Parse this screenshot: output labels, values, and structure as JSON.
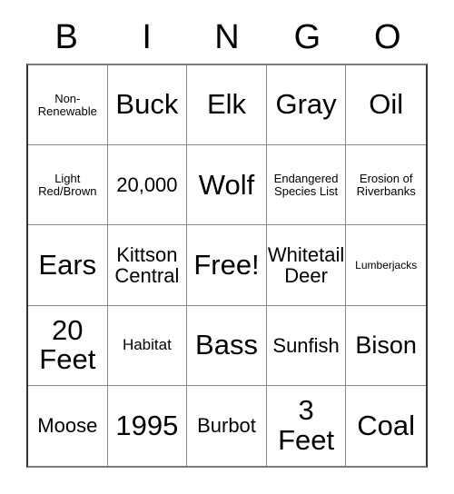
{
  "card": {
    "header_letters": [
      "B",
      "I",
      "N",
      "G",
      "O"
    ],
    "free_space_label": "Free!",
    "rows": [
      [
        {
          "text": "Non-\nRenewable",
          "size": "xs"
        },
        {
          "text": "Buck",
          "size": "xl"
        },
        {
          "text": "Elk",
          "size": "xl"
        },
        {
          "text": "Gray",
          "size": "xl"
        },
        {
          "text": "Oil",
          "size": "xl"
        }
      ],
      [
        {
          "text": "Light\nRed/Brown",
          "size": "xs"
        },
        {
          "text": "20,000",
          "size": "md"
        },
        {
          "text": "Wolf",
          "size": "xl"
        },
        {
          "text": "Endangered\nSpecies List",
          "size": "xs"
        },
        {
          "text": "Erosion of\nRiverbanks",
          "size": "xs"
        }
      ],
      [
        {
          "text": "Ears",
          "size": "xl"
        },
        {
          "text": "Kittson\nCentral",
          "size": "md"
        },
        {
          "text": "Free!",
          "size": "xl"
        },
        {
          "text": "Whitetail\nDeer",
          "size": "md"
        },
        {
          "text": "Lumberjacks",
          "size": "xxs"
        }
      ],
      [
        {
          "text": "20\nFeet",
          "size": "xl"
        },
        {
          "text": "Habitat",
          "size": "sm"
        },
        {
          "text": "Bass",
          "size": "xl"
        },
        {
          "text": "Sunfish",
          "size": "md"
        },
        {
          "text": "Bison",
          "size": "lg"
        }
      ],
      [
        {
          "text": "Moose",
          "size": "md"
        },
        {
          "text": "1995",
          "size": "xl"
        },
        {
          "text": "Burbot",
          "size": "md"
        },
        {
          "text": "3\nFeet",
          "size": "xl"
        },
        {
          "text": "Coal",
          "size": "xl"
        }
      ]
    ],
    "colors": {
      "background": "#ffffff",
      "text": "#000000",
      "grid_line": "#8a8a8a",
      "outer_border": "#333333"
    }
  }
}
